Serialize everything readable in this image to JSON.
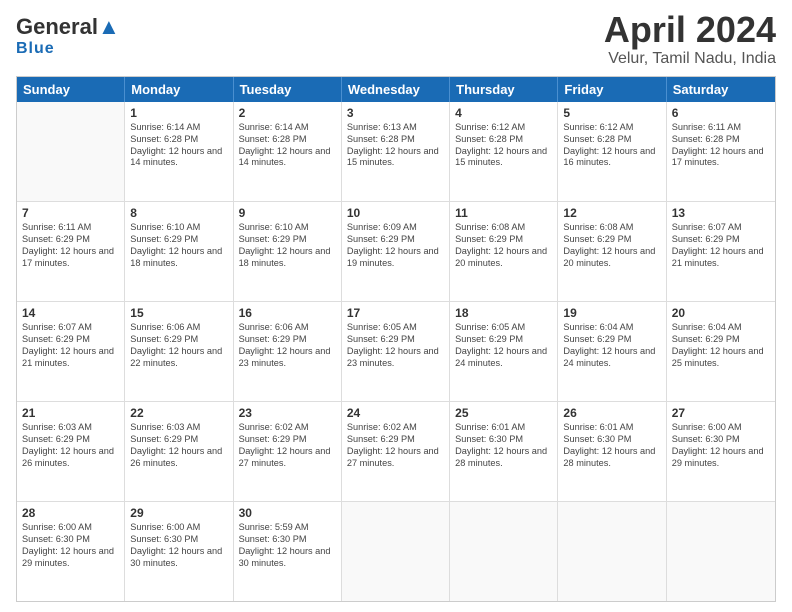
{
  "header": {
    "logo_general": "General",
    "logo_blue": "Blue",
    "title": "April 2024",
    "subtitle": "Velur, Tamil Nadu, India"
  },
  "days_of_week": [
    "Sunday",
    "Monday",
    "Tuesday",
    "Wednesday",
    "Thursday",
    "Friday",
    "Saturday"
  ],
  "weeks": [
    [
      {
        "day": "",
        "sunrise": "",
        "sunset": "",
        "daylight": ""
      },
      {
        "day": "1",
        "sunrise": "Sunrise: 6:14 AM",
        "sunset": "Sunset: 6:28 PM",
        "daylight": "Daylight: 12 hours and 14 minutes."
      },
      {
        "day": "2",
        "sunrise": "Sunrise: 6:14 AM",
        "sunset": "Sunset: 6:28 PM",
        "daylight": "Daylight: 12 hours and 14 minutes."
      },
      {
        "day": "3",
        "sunrise": "Sunrise: 6:13 AM",
        "sunset": "Sunset: 6:28 PM",
        "daylight": "Daylight: 12 hours and 15 minutes."
      },
      {
        "day": "4",
        "sunrise": "Sunrise: 6:12 AM",
        "sunset": "Sunset: 6:28 PM",
        "daylight": "Daylight: 12 hours and 15 minutes."
      },
      {
        "day": "5",
        "sunrise": "Sunrise: 6:12 AM",
        "sunset": "Sunset: 6:28 PM",
        "daylight": "Daylight: 12 hours and 16 minutes."
      },
      {
        "day": "6",
        "sunrise": "Sunrise: 6:11 AM",
        "sunset": "Sunset: 6:28 PM",
        "daylight": "Daylight: 12 hours and 17 minutes."
      }
    ],
    [
      {
        "day": "7",
        "sunrise": "Sunrise: 6:11 AM",
        "sunset": "Sunset: 6:29 PM",
        "daylight": "Daylight: 12 hours and 17 minutes."
      },
      {
        "day": "8",
        "sunrise": "Sunrise: 6:10 AM",
        "sunset": "Sunset: 6:29 PM",
        "daylight": "Daylight: 12 hours and 18 minutes."
      },
      {
        "day": "9",
        "sunrise": "Sunrise: 6:10 AM",
        "sunset": "Sunset: 6:29 PM",
        "daylight": "Daylight: 12 hours and 18 minutes."
      },
      {
        "day": "10",
        "sunrise": "Sunrise: 6:09 AM",
        "sunset": "Sunset: 6:29 PM",
        "daylight": "Daylight: 12 hours and 19 minutes."
      },
      {
        "day": "11",
        "sunrise": "Sunrise: 6:08 AM",
        "sunset": "Sunset: 6:29 PM",
        "daylight": "Daylight: 12 hours and 20 minutes."
      },
      {
        "day": "12",
        "sunrise": "Sunrise: 6:08 AM",
        "sunset": "Sunset: 6:29 PM",
        "daylight": "Daylight: 12 hours and 20 minutes."
      },
      {
        "day": "13",
        "sunrise": "Sunrise: 6:07 AM",
        "sunset": "Sunset: 6:29 PM",
        "daylight": "Daylight: 12 hours and 21 minutes."
      }
    ],
    [
      {
        "day": "14",
        "sunrise": "Sunrise: 6:07 AM",
        "sunset": "Sunset: 6:29 PM",
        "daylight": "Daylight: 12 hours and 21 minutes."
      },
      {
        "day": "15",
        "sunrise": "Sunrise: 6:06 AM",
        "sunset": "Sunset: 6:29 PM",
        "daylight": "Daylight: 12 hours and 22 minutes."
      },
      {
        "day": "16",
        "sunrise": "Sunrise: 6:06 AM",
        "sunset": "Sunset: 6:29 PM",
        "daylight": "Daylight: 12 hours and 23 minutes."
      },
      {
        "day": "17",
        "sunrise": "Sunrise: 6:05 AM",
        "sunset": "Sunset: 6:29 PM",
        "daylight": "Daylight: 12 hours and 23 minutes."
      },
      {
        "day": "18",
        "sunrise": "Sunrise: 6:05 AM",
        "sunset": "Sunset: 6:29 PM",
        "daylight": "Daylight: 12 hours and 24 minutes."
      },
      {
        "day": "19",
        "sunrise": "Sunrise: 6:04 AM",
        "sunset": "Sunset: 6:29 PM",
        "daylight": "Daylight: 12 hours and 24 minutes."
      },
      {
        "day": "20",
        "sunrise": "Sunrise: 6:04 AM",
        "sunset": "Sunset: 6:29 PM",
        "daylight": "Daylight: 12 hours and 25 minutes."
      }
    ],
    [
      {
        "day": "21",
        "sunrise": "Sunrise: 6:03 AM",
        "sunset": "Sunset: 6:29 PM",
        "daylight": "Daylight: 12 hours and 26 minutes."
      },
      {
        "day": "22",
        "sunrise": "Sunrise: 6:03 AM",
        "sunset": "Sunset: 6:29 PM",
        "daylight": "Daylight: 12 hours and 26 minutes."
      },
      {
        "day": "23",
        "sunrise": "Sunrise: 6:02 AM",
        "sunset": "Sunset: 6:29 PM",
        "daylight": "Daylight: 12 hours and 27 minutes."
      },
      {
        "day": "24",
        "sunrise": "Sunrise: 6:02 AM",
        "sunset": "Sunset: 6:29 PM",
        "daylight": "Daylight: 12 hours and 27 minutes."
      },
      {
        "day": "25",
        "sunrise": "Sunrise: 6:01 AM",
        "sunset": "Sunset: 6:30 PM",
        "daylight": "Daylight: 12 hours and 28 minutes."
      },
      {
        "day": "26",
        "sunrise": "Sunrise: 6:01 AM",
        "sunset": "Sunset: 6:30 PM",
        "daylight": "Daylight: 12 hours and 28 minutes."
      },
      {
        "day": "27",
        "sunrise": "Sunrise: 6:00 AM",
        "sunset": "Sunset: 6:30 PM",
        "daylight": "Daylight: 12 hours and 29 minutes."
      }
    ],
    [
      {
        "day": "28",
        "sunrise": "Sunrise: 6:00 AM",
        "sunset": "Sunset: 6:30 PM",
        "daylight": "Daylight: 12 hours and 29 minutes."
      },
      {
        "day": "29",
        "sunrise": "Sunrise: 6:00 AM",
        "sunset": "Sunset: 6:30 PM",
        "daylight": "Daylight: 12 hours and 30 minutes."
      },
      {
        "day": "30",
        "sunrise": "Sunrise: 5:59 AM",
        "sunset": "Sunset: 6:30 PM",
        "daylight": "Daylight: 12 hours and 30 minutes."
      },
      {
        "day": "",
        "sunrise": "",
        "sunset": "",
        "daylight": ""
      },
      {
        "day": "",
        "sunrise": "",
        "sunset": "",
        "daylight": ""
      },
      {
        "day": "",
        "sunrise": "",
        "sunset": "",
        "daylight": ""
      },
      {
        "day": "",
        "sunrise": "",
        "sunset": "",
        "daylight": ""
      }
    ]
  ]
}
